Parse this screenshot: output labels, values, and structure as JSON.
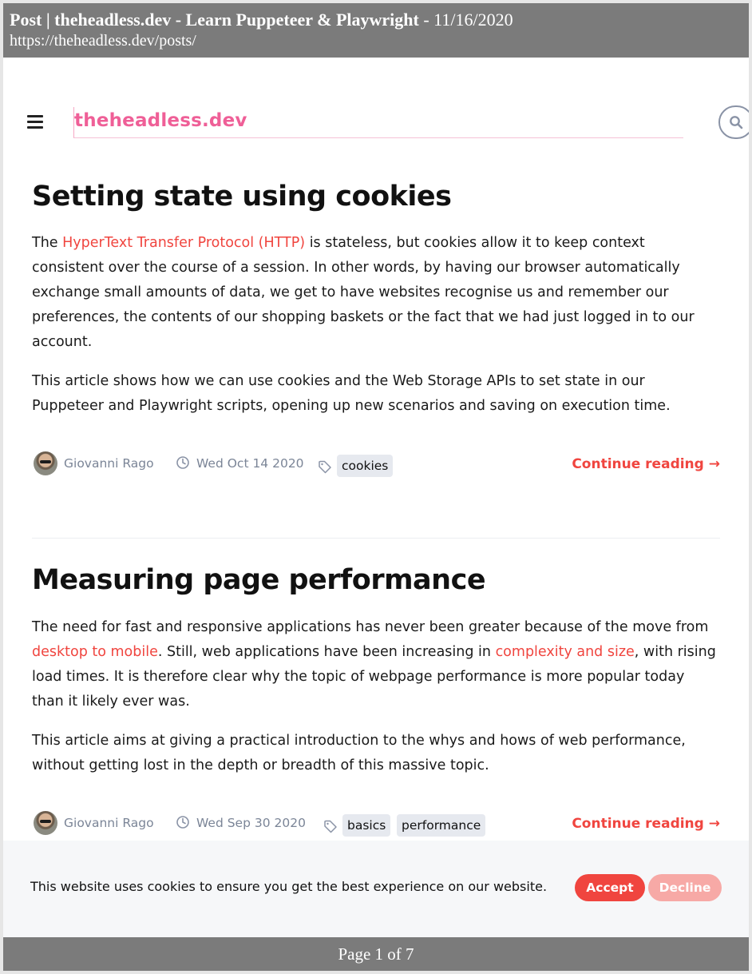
{
  "print_header": {
    "title_bold": "Post | theheadless.dev - Learn Puppeteer & Playwright",
    "title_suffix": " - 11/16/2020",
    "url": "https://theheadless.dev/posts/"
  },
  "nav": {
    "menu_icon": "hamburger-menu-icon",
    "brand": "theheadless.dev",
    "search_icon": "search-icon"
  },
  "posts": [
    {
      "title": "Setting state using cookies",
      "p1_before": "The ",
      "p1_link": "HyperText Transfer Protocol (HTTP)",
      "p1_after": " is stateless, but cookies allow it to keep context consistent over the course of a session. In other words, by having our browser automatically exchange small amounts of data, we get to have websites recognise us and remember our preferences, the contents of our shopping baskets or the fact that we had just logged in to our account.",
      "p2": "This article shows how we can use cookies and the Web Storage APIs to set state in our Puppeteer and Playwright scripts, opening up new scenarios and saving on execution time.",
      "author": "Giovanni Rago",
      "date": "Wed Oct 14 2020",
      "tags": [
        "cookies"
      ],
      "continue": "Continue reading →"
    },
    {
      "title": "Measuring page performance",
      "p1_a": "The need for fast and responsive applications has never been greater because of the move from ",
      "p1_link1": "desktop to mobile",
      "p1_b": ". Still, web applications have been increasing in ",
      "p1_link2": "complexity and size",
      "p1_c": ", with rising load times. It is therefore clear why the topic of webpage performance is more popular today than it likely ever was.",
      "p2": "This article aims at giving a practical introduction to the whys and hows of web performance, without getting lost in the depth or breadth of this massive topic.",
      "author": "Giovanni Rago",
      "date": "Wed Sep 30 2020",
      "tags": [
        "basics",
        "performance"
      ],
      "continue": "Continue reading →"
    }
  ],
  "cookie_banner": {
    "text": "This website uses cookies to ensure you get the best experience on our website.",
    "accept": "Accept",
    "decline": "Decline"
  },
  "print_footer": "Page 1 of 7",
  "colors": {
    "brand": "#ef5f97",
    "accent": "#f0453f",
    "muted": "#7b8597"
  }
}
